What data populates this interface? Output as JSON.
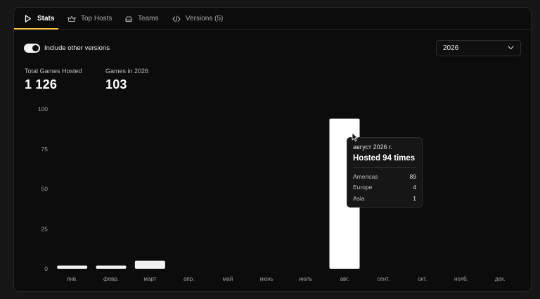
{
  "tabs": [
    {
      "label": "Stats",
      "icon": "play-icon",
      "active": true
    },
    {
      "label": "Top Hosts",
      "icon": "crown-icon",
      "active": false
    },
    {
      "label": "Teams",
      "icon": "car-icon",
      "active": false
    },
    {
      "label": "Versions (5)",
      "icon": "code-icon",
      "active": false
    }
  ],
  "controls": {
    "toggle_label": "Include other versions",
    "toggle_on": true,
    "year_selected": "2026"
  },
  "stats": {
    "total_label": "Total Games Hosted",
    "total_value": "1 126",
    "year_label": "Games in 2026",
    "year_value": "103"
  },
  "colors": {
    "accent": "#f4c542",
    "bar": "#f2f2f2",
    "bar_highlight": "#ffffff"
  },
  "chart_data": {
    "type": "bar",
    "categories": [
      "янв.",
      "февр.",
      "март",
      "апр.",
      "май",
      "июнь",
      "июль",
      "авг.",
      "сент.",
      "окт.",
      "нояб.",
      "дек."
    ],
    "values": [
      2,
      2,
      5,
      0,
      0,
      0,
      0,
      94,
      0,
      0,
      0,
      0
    ],
    "ylim": [
      0,
      100
    ],
    "yticks": [
      0,
      25,
      50,
      75,
      100
    ],
    "grid": false,
    "highlight_index": 7
  },
  "tooltip": {
    "date": "август 2026 г.",
    "headline": "Hosted 94 times",
    "rows": [
      {
        "region": "Americas",
        "count": "89"
      },
      {
        "region": "Europe",
        "count": "4"
      },
      {
        "region": "Asia",
        "count": "1"
      }
    ]
  }
}
